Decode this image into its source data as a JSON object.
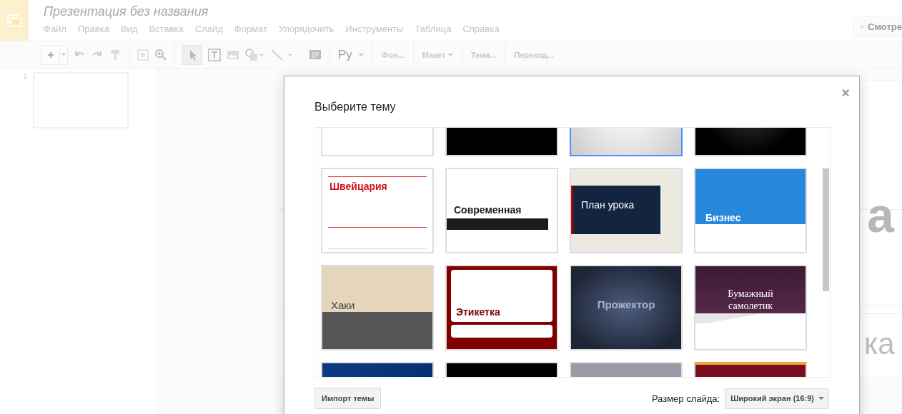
{
  "document": {
    "title": "Презентация без названия"
  },
  "menu": [
    "Файл",
    "Правка",
    "Вид",
    "Вставка",
    "Слайд",
    "Формат",
    "Упорядочить",
    "Инструменты",
    "Таблица",
    "Справка"
  ],
  "present_button": {
    "label": "Смотре"
  },
  "toolbar": {
    "input_tools": "Ру",
    "text_buttons": [
      {
        "label": "Фон...",
        "dropdown": false
      },
      {
        "label": "Макет",
        "dropdown": true
      },
      {
        "label": "Тема...",
        "dropdown": false
      },
      {
        "label": "Переход...",
        "dropdown": false
      }
    ]
  },
  "filmstrip": [
    {
      "number": "1"
    }
  ],
  "slide": {
    "title_fragment": "а",
    "subtitle_fragment": "ка"
  },
  "dialog": {
    "title": "Выберите тему",
    "close": "×",
    "themes": [
      {
        "kind": "plain",
        "selected": false
      },
      {
        "kind": "black",
        "selected": false
      },
      {
        "kind": "silver",
        "selected": true
      },
      {
        "kind": "dark",
        "selected": false
      },
      {
        "kind": "swiss",
        "name": "Швейцария",
        "selected": false
      },
      {
        "kind": "modern",
        "name": "Современная",
        "selected": false
      },
      {
        "kind": "lesson",
        "name": "План урока",
        "selected": false
      },
      {
        "kind": "business",
        "name": "Бизнес",
        "selected": false
      },
      {
        "kind": "khaki",
        "name": "Хаки",
        "selected": false
      },
      {
        "kind": "label",
        "name": "Этикетка",
        "selected": false
      },
      {
        "kind": "spotlight",
        "name": "Прожектор",
        "selected": false
      },
      {
        "kind": "paper",
        "name": "Бумажный самолетик",
        "selected": false
      },
      {
        "kind": "blue",
        "selected": false
      },
      {
        "kind": "black",
        "selected": false
      },
      {
        "kind": "grey",
        "selected": false
      },
      {
        "kind": "colorful",
        "selected": false
      }
    ],
    "import_button": "Импорт темы",
    "size_label": "Размер слайда:",
    "size_value": "Широкий экран (16:9)"
  }
}
